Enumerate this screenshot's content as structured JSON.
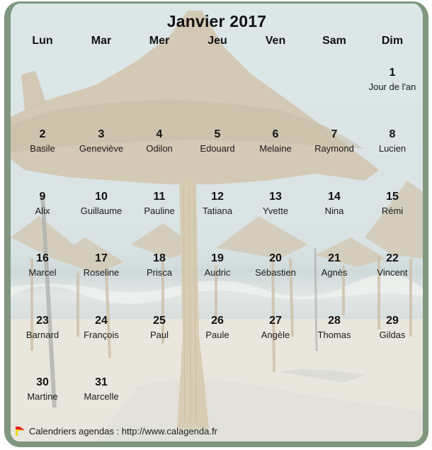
{
  "calendar": {
    "title": "Janvier 2017",
    "weekdays": [
      "Lun",
      "Mar",
      "Mer",
      "Jeu",
      "Ven",
      "Sam",
      "Dim"
    ],
    "days": [
      {
        "day": "1",
        "saint": "Jour de l'an",
        "weekday_index": 6,
        "week": 0
      },
      {
        "day": "2",
        "saint": "Basile",
        "weekday_index": 0,
        "week": 1
      },
      {
        "day": "3",
        "saint": "Geneviève",
        "weekday_index": 1,
        "week": 1
      },
      {
        "day": "4",
        "saint": "Odilon",
        "weekday_index": 2,
        "week": 1
      },
      {
        "day": "5",
        "saint": "Edouard",
        "weekday_index": 3,
        "week": 1
      },
      {
        "day": "6",
        "saint": "Melaine",
        "weekday_index": 4,
        "week": 1
      },
      {
        "day": "7",
        "saint": "Raymond",
        "weekday_index": 5,
        "week": 1
      },
      {
        "day": "8",
        "saint": "Lucien",
        "weekday_index": 6,
        "week": 1
      },
      {
        "day": "9",
        "saint": "Alix",
        "weekday_index": 0,
        "week": 2
      },
      {
        "day": "10",
        "saint": "Guillaume",
        "weekday_index": 1,
        "week": 2
      },
      {
        "day": "11",
        "saint": "Pauline",
        "weekday_index": 2,
        "week": 2
      },
      {
        "day": "12",
        "saint": "Tatiana",
        "weekday_index": 3,
        "week": 2
      },
      {
        "day": "13",
        "saint": "Yvette",
        "weekday_index": 4,
        "week": 2
      },
      {
        "day": "14",
        "saint": "Nina",
        "weekday_index": 5,
        "week": 2
      },
      {
        "day": "15",
        "saint": "Rémi",
        "weekday_index": 6,
        "week": 2
      },
      {
        "day": "16",
        "saint": "Marcel",
        "weekday_index": 0,
        "week": 3
      },
      {
        "day": "17",
        "saint": "Roseline",
        "weekday_index": 1,
        "week": 3
      },
      {
        "day": "18",
        "saint": "Prisca",
        "weekday_index": 2,
        "week": 3
      },
      {
        "day": "19",
        "saint": "Audric",
        "weekday_index": 3,
        "week": 3
      },
      {
        "day": "20",
        "saint": "Sébastien",
        "weekday_index": 4,
        "week": 3
      },
      {
        "day": "21",
        "saint": "Agnès",
        "weekday_index": 5,
        "week": 3
      },
      {
        "day": "22",
        "saint": "Vincent",
        "weekday_index": 6,
        "week": 3
      },
      {
        "day": "23",
        "saint": "Barnard",
        "weekday_index": 0,
        "week": 4
      },
      {
        "day": "24",
        "saint": "François",
        "weekday_index": 1,
        "week": 4
      },
      {
        "day": "25",
        "saint": "Paul",
        "weekday_index": 2,
        "week": 4
      },
      {
        "day": "26",
        "saint": "Paule",
        "weekday_index": 3,
        "week": 4
      },
      {
        "day": "27",
        "saint": "Angèle",
        "weekday_index": 4,
        "week": 4
      },
      {
        "day": "28",
        "saint": "Thomas",
        "weekday_index": 5,
        "week": 4
      },
      {
        "day": "29",
        "saint": "Gildas",
        "weekday_index": 6,
        "week": 4
      },
      {
        "day": "30",
        "saint": "Martine",
        "weekday_index": 0,
        "week": 5
      },
      {
        "day": "31",
        "saint": "Marcelle",
        "weekday_index": 1,
        "week": 5
      }
    ]
  },
  "footer": {
    "icon": "flag-icon",
    "text": "Calendriers agendas : http://www.calagenda.fr"
  },
  "colors": {
    "frame": "#7f977e",
    "sky": "#d6e2e3",
    "sand": "#e6e4da",
    "straw": "#c9bba3"
  }
}
